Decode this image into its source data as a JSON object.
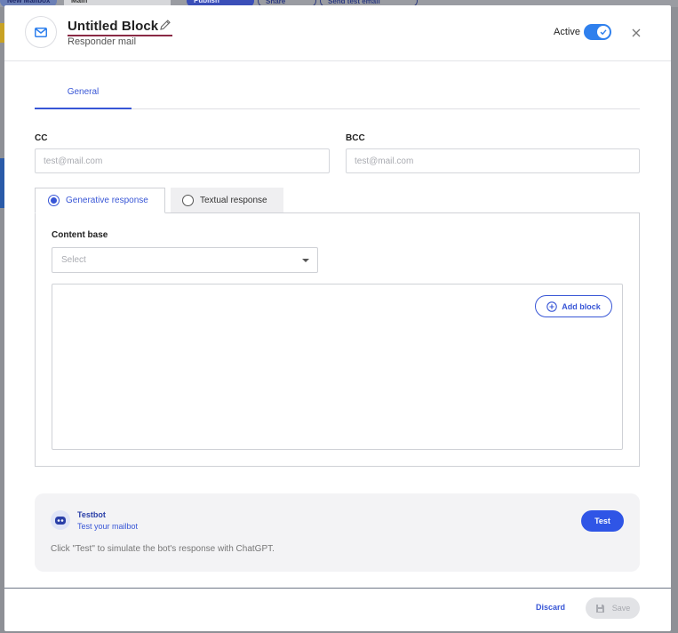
{
  "background": {
    "chips": [
      "New Mailbox",
      "Main",
      "Publish",
      "Share",
      "Send test email"
    ]
  },
  "header": {
    "title": "Untitled Block",
    "subtitle": "Responder mail",
    "active_label": "Active",
    "active_on": true,
    "icons": {
      "block": "mail-icon",
      "edit": "pencil-icon",
      "close": "close-icon"
    }
  },
  "tabs": [
    {
      "label": "General",
      "selected": true
    }
  ],
  "form": {
    "cc": {
      "label": "CC",
      "placeholder": "test@mail.com",
      "value": ""
    },
    "bcc": {
      "label": "BCC",
      "placeholder": "test@mail.com",
      "value": ""
    }
  },
  "response_tabs": [
    {
      "label": "Generative response",
      "selected": true
    },
    {
      "label": "Textual response",
      "selected": false
    }
  ],
  "generative": {
    "content_base_label": "Content base",
    "select_placeholder": "Select",
    "add_block_label": "Add block"
  },
  "testbot": {
    "name": "Testbot",
    "subtitle": "Test your mailbot",
    "description": "Click \"Test\" to simulate the bot's response with ChatGPT.",
    "test_label": "Test"
  },
  "footer": {
    "discard_label": "Discard",
    "save_label": "Save",
    "save_enabled": false
  },
  "colors": {
    "accent": "#3856d6",
    "toggle": "#2f80ed",
    "test_button": "#2f55e6",
    "title_underline": "#8a2a45"
  }
}
